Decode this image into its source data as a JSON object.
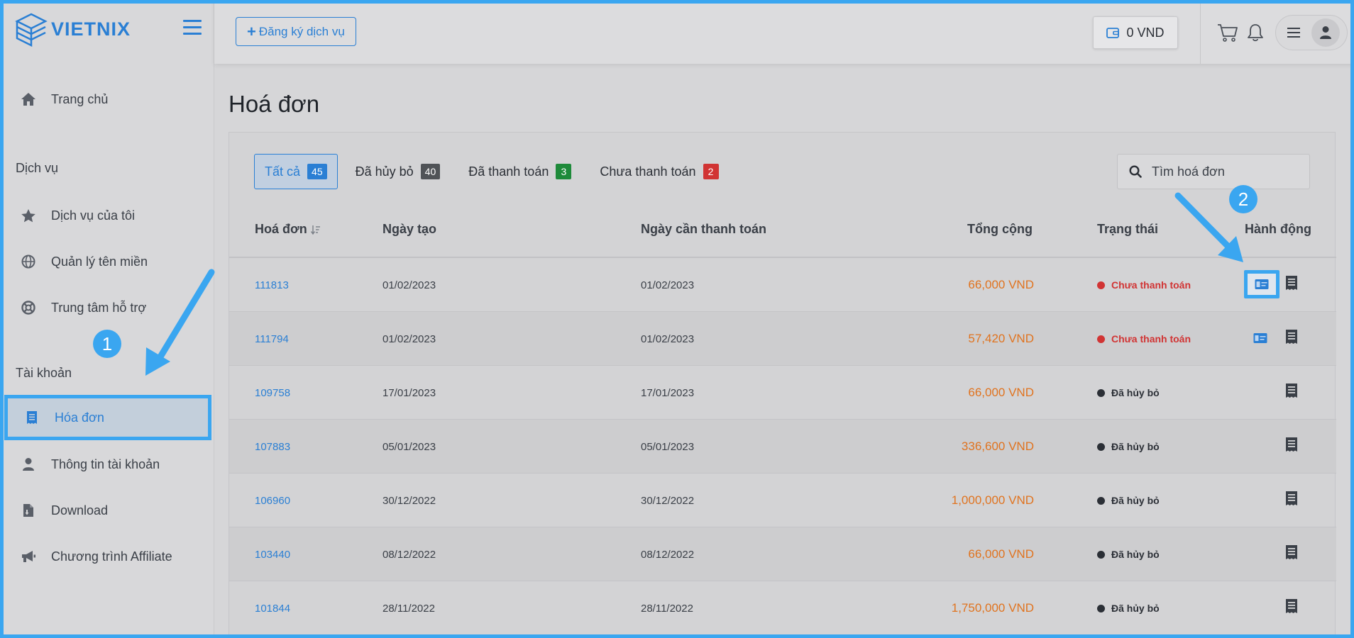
{
  "brand": {
    "name": "VIETNIX"
  },
  "sidebar": {
    "home": "Trang chủ",
    "section_services": "Dịch vụ",
    "my_services": "Dịch vụ của tôi",
    "domains": "Quản lý tên miền",
    "support": "Trung tâm hỗ trợ",
    "section_account": "Tài khoản",
    "invoices": "Hóa đơn",
    "account_info": "Thông tin tài khoản",
    "download": "Download",
    "affiliate": "Chương trình Affiliate"
  },
  "header": {
    "register_label": "Đăng ký dịch vụ",
    "balance": "0 VND"
  },
  "page": {
    "title": "Hoá đơn"
  },
  "tabs": [
    {
      "label": "Tất cả",
      "count": "45",
      "color": "#2a7fd4"
    },
    {
      "label": "Đã hủy bỏ",
      "count": "40",
      "color": "#505357"
    },
    {
      "label": "Đã thanh toán",
      "count": "3",
      "color": "#1e8a3a"
    },
    {
      "label": "Chưa thanh toán",
      "count": "2",
      "color": "#d13434"
    }
  ],
  "search": {
    "placeholder": "Tìm hoá đơn"
  },
  "table": {
    "headers": {
      "invoice": "Hoá đơn",
      "created": "Ngày tạo",
      "due": "Ngày cần thanh toán",
      "total": "Tổng cộng",
      "status": "Trạng thái",
      "actions": "Hành động"
    },
    "rows": [
      {
        "id": "111813",
        "created": "01/02/2023",
        "due": "01/02/2023",
        "total": "66,000 VND",
        "status": "Chưa thanh toán"
      },
      {
        "id": "111794",
        "created": "01/02/2023",
        "due": "01/02/2023",
        "total": "57,420 VND",
        "status": "Chưa thanh toán"
      },
      {
        "id": "109758",
        "created": "17/01/2023",
        "due": "17/01/2023",
        "total": "66,000 VND",
        "status": "Đã hủy bỏ"
      },
      {
        "id": "107883",
        "created": "05/01/2023",
        "due": "05/01/2023",
        "total": "336,600 VND",
        "status": "Đã hủy bỏ"
      },
      {
        "id": "106960",
        "created": "30/12/2022",
        "due": "30/12/2022",
        "total": "1,000,000 VND",
        "status": "Đã hủy bỏ"
      },
      {
        "id": "103440",
        "created": "08/12/2022",
        "due": "08/12/2022",
        "total": "66,000 VND",
        "status": "Đã hủy bỏ"
      },
      {
        "id": "101844",
        "created": "28/11/2022",
        "due": "28/11/2022",
        "total": "1,750,000 VND",
        "status": "Đã hủy bỏ"
      }
    ]
  },
  "status_colors": {
    "unpaid": "#d13434",
    "cancelled": "#2b2f36"
  },
  "callouts": [
    "1",
    "2"
  ]
}
